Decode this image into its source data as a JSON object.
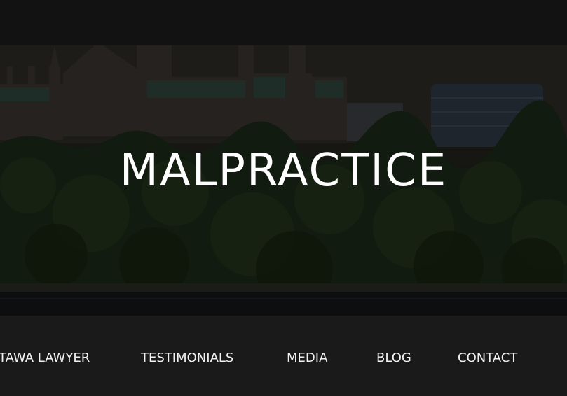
{
  "hero": {
    "title": "MALPRACTICE",
    "background": "city-skyline-photo"
  },
  "nav": {
    "items": [
      {
        "label": "TAWA LAWYER"
      },
      {
        "label": "TESTIMONIALS"
      },
      {
        "label": "MEDIA"
      },
      {
        "label": "BLOG"
      },
      {
        "label": "CONTACT"
      }
    ]
  }
}
